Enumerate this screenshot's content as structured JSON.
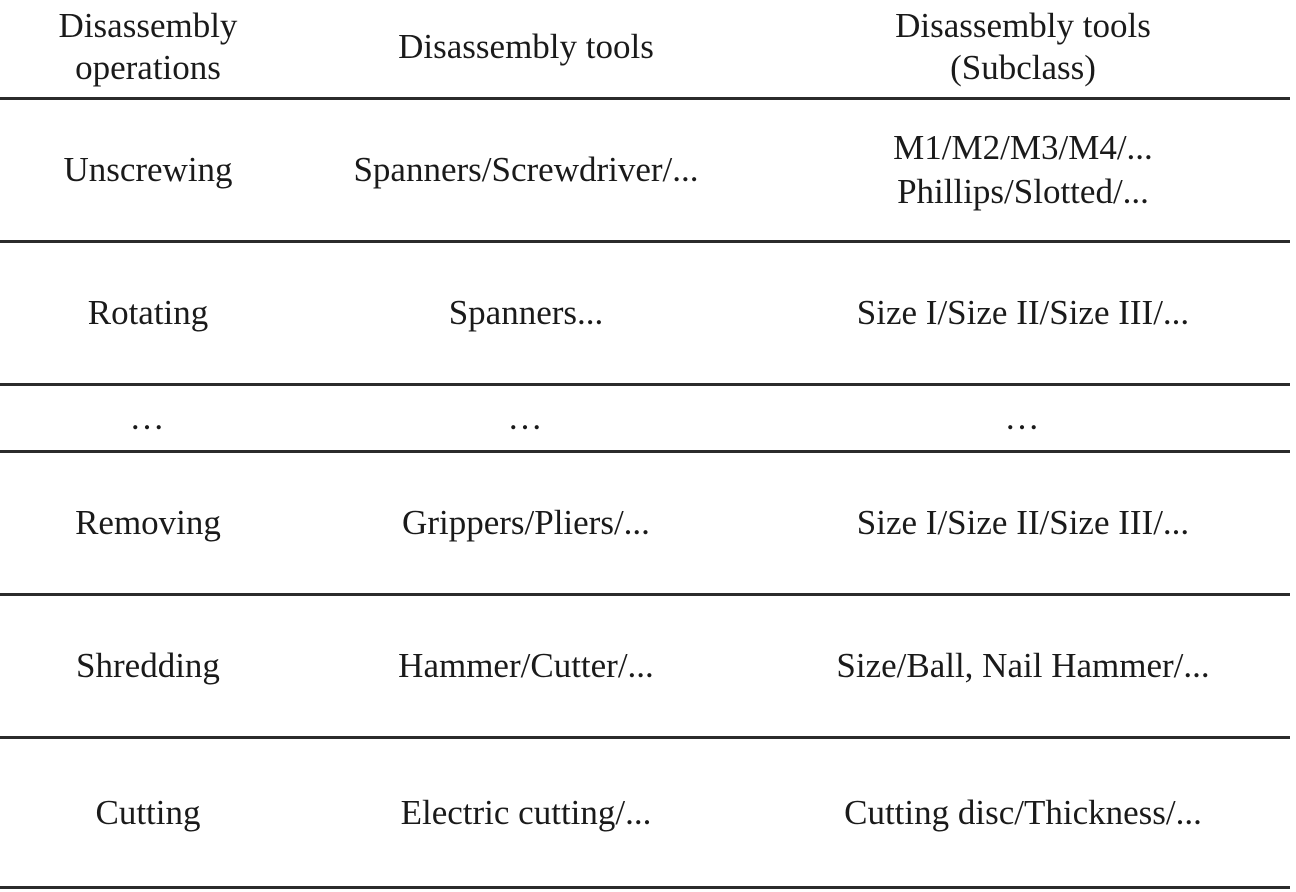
{
  "table": {
    "columns": [
      {
        "id": "operations",
        "header_lines": [
          "Disassembly",
          "operations"
        ]
      },
      {
        "id": "tools",
        "header_lines": [
          "Disassembly tools"
        ]
      },
      {
        "id": "subclass",
        "header_lines": [
          "Disassembly tools",
          "(Subclass)"
        ]
      }
    ],
    "rows": [
      {
        "kind": "data",
        "operations": [
          "Unscrewing"
        ],
        "tools": [
          "Spanners/Screwdriver/..."
        ],
        "subclass": [
          "M1/M2/M3/M4/...",
          "Phillips/Slotted/..."
        ]
      },
      {
        "kind": "data",
        "operations": [
          "Rotating"
        ],
        "tools": [
          "Spanners..."
        ],
        "subclass": [
          "Size I/Size II/Size III/..."
        ]
      },
      {
        "kind": "ellipsis",
        "operations": [
          "…"
        ],
        "tools": [
          "…"
        ],
        "subclass": [
          "…"
        ]
      },
      {
        "kind": "data",
        "operations": [
          "Removing"
        ],
        "tools": [
          "Grippers/Pliers/..."
        ],
        "subclass": [
          "Size I/Size II/Size III/..."
        ]
      },
      {
        "kind": "data",
        "operations": [
          "Shredding"
        ],
        "tools": [
          "Hammer/Cutter/..."
        ],
        "subclass": [
          "Size/Ball, Nail Hammer/..."
        ]
      },
      {
        "kind": "data",
        "operations": [
          "Cutting"
        ],
        "tools": [
          "Electric cutting/..."
        ],
        "subclass": [
          "Cutting disc/Thickness/..."
        ]
      }
    ],
    "style": {
      "rule_color": "#2b2b2b",
      "text_color": "#1a1a1a",
      "background": "#ffffff"
    }
  }
}
